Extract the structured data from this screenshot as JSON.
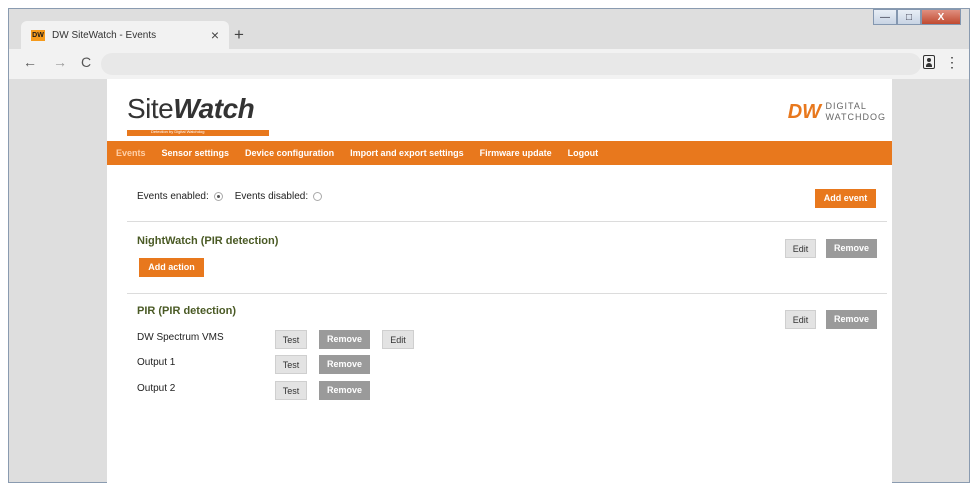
{
  "browser": {
    "tab_favicon": "DW",
    "tab_title": "DW SiteWatch - Events",
    "tab_close": "×",
    "new_tab": "+",
    "back": "←",
    "forward": "→",
    "reload": "C",
    "menu": "⋮",
    "window_controls": {
      "minimize": "—",
      "maximize": "□",
      "close": "X"
    }
  },
  "header": {
    "logo_text_plain": "Site",
    "logo_text_bold": "Watch",
    "logo_tagline": "Detection by Digital Watchdog",
    "brand_mark": "DW",
    "brand_words_line1": "DIGITAL",
    "brand_words_line2": "WATCHDOG"
  },
  "nav": {
    "items": [
      {
        "label": "Events",
        "active": true
      },
      {
        "label": "Sensor settings",
        "active": false
      },
      {
        "label": "Device configuration",
        "active": false
      },
      {
        "label": "Import and export settings",
        "active": false
      },
      {
        "label": "Firmware update",
        "active": false
      },
      {
        "label": "Logout",
        "active": false
      }
    ]
  },
  "events_toggle": {
    "enabled_label": "Events enabled:",
    "disabled_label": "Events disabled:",
    "selected": "enabled"
  },
  "add_event_label": "Add event",
  "events": [
    {
      "title": "NightWatch (PIR detection)",
      "edit_label": "Edit",
      "remove_label": "Remove",
      "add_action_label": "Add action",
      "actions": []
    },
    {
      "title": "PIR (PIR detection)",
      "edit_label": "Edit",
      "remove_label": "Remove",
      "actions": [
        {
          "name": "DW Spectrum VMS",
          "test_label": "Test",
          "remove_label": "Remove",
          "edit_label": "Edit"
        },
        {
          "name": "Output 1",
          "test_label": "Test",
          "remove_label": "Remove"
        },
        {
          "name": "Output 2",
          "test_label": "Test",
          "remove_label": "Remove"
        }
      ]
    }
  ],
  "colors": {
    "accent": "#e8781d",
    "event_title": "#4a5a25",
    "dark_button": "#9a9a9a"
  }
}
